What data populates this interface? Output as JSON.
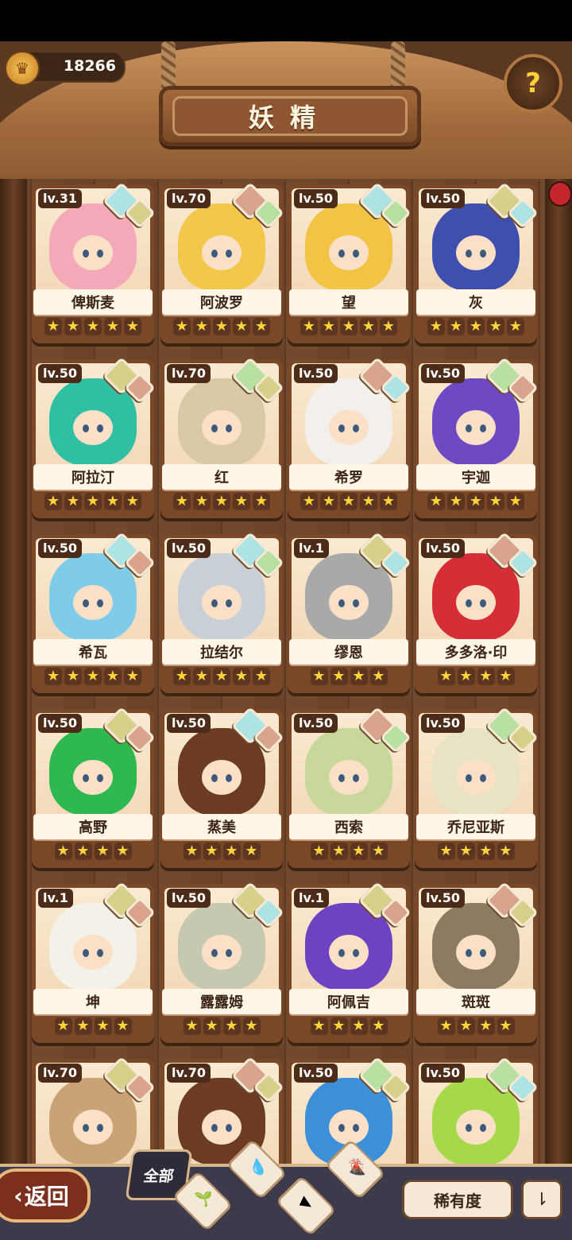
{
  "header": {
    "title": "妖精",
    "coins": "18266",
    "coin_icon": "crown-coin-icon",
    "help_icon": "question-sprout-icon"
  },
  "cards": [
    {
      "level": "lv.31",
      "name": "俾斯麦",
      "stars": 5,
      "hair": "#f4a9b8",
      "badges": [
        "#aee3e3",
        "#d8cf8a"
      ]
    },
    {
      "level": "lv.70",
      "name": "阿波罗",
      "stars": 5,
      "hair": "#f3c84a",
      "badges": [
        "#d9a38c",
        "#b8e0a0"
      ]
    },
    {
      "level": "lv.50",
      "name": "望",
      "stars": 5,
      "hair": "#f2c445",
      "badges": [
        "#aee3e3",
        "#b8e0a0"
      ]
    },
    {
      "level": "lv.50",
      "name": "灰",
      "stars": 5,
      "hair": "#3e4fae",
      "badges": [
        "#d8cf8a",
        "#aee3e3"
      ]
    },
    {
      "level": "lv.50",
      "name": "阿拉汀",
      "stars": 5,
      "hair": "#2fbfa3",
      "badges": [
        "#d8cf8a",
        "#d9a38c"
      ]
    },
    {
      "level": "lv.70",
      "name": "红",
      "stars": 5,
      "hair": "#d9c9a6",
      "badges": [
        "#b8e0a0",
        "#d8cf8a"
      ]
    },
    {
      "level": "lv.50",
      "name": "希罗",
      "stars": 5,
      "hair": "#f3f0ec",
      "badges": [
        "#d9a38c",
        "#aee3e3"
      ]
    },
    {
      "level": "lv.50",
      "name": "宇迦",
      "stars": 5,
      "hair": "#6d49c4",
      "badges": [
        "#b8e0a0",
        "#d9a38c"
      ]
    },
    {
      "level": "lv.50",
      "name": "希瓦",
      "stars": 5,
      "hair": "#7ecbea",
      "badges": [
        "#aee3e3",
        "#d9a38c"
      ]
    },
    {
      "level": "lv.50",
      "name": "拉结尔",
      "stars": 5,
      "hair": "#c9cfd6",
      "badges": [
        "#aee3e3",
        "#b8e0a0"
      ]
    },
    {
      "level": "lv.1",
      "name": "缪恩",
      "stars": 4,
      "hair": "#a9a9a9",
      "badges": [
        "#d8cf8a",
        "#aee3e3"
      ]
    },
    {
      "level": "lv.50",
      "name": "多多洛·印",
      "stars": 4,
      "hair": "#d62d36",
      "badges": [
        "#d9a38c",
        "#aee3e3"
      ]
    },
    {
      "level": "lv.50",
      "name": "高野",
      "stars": 4,
      "hair": "#2fb84f",
      "badges": [
        "#d8cf8a",
        "#d9a38c"
      ]
    },
    {
      "level": "lv.50",
      "name": "蒸美",
      "stars": 4,
      "hair": "#6b3c22",
      "badges": [
        "#aee3e3",
        "#d9a38c"
      ]
    },
    {
      "level": "lv.50",
      "name": "西索",
      "stars": 4,
      "hair": "#c8d79a",
      "badges": [
        "#d9a38c",
        "#b8e0a0"
      ]
    },
    {
      "level": "lv.50",
      "name": "乔尼亚斯",
      "stars": 4,
      "hair": "#e7e3c4",
      "badges": [
        "#b8e0a0",
        "#d8cf8a"
      ]
    },
    {
      "level": "lv.1",
      "name": "坤",
      "stars": 4,
      "hair": "#f4f2e8",
      "badges": [
        "#d8cf8a",
        "#d9a38c"
      ]
    },
    {
      "level": "lv.50",
      "name": "露露姆",
      "stars": 4,
      "hair": "#c7c8b0",
      "badges": [
        "#d8cf8a",
        "#aee3e3"
      ]
    },
    {
      "level": "lv.1",
      "name": "阿佩吉",
      "stars": 4,
      "hair": "#6f42c1",
      "badges": [
        "#d8cf8a",
        "#d9a38c"
      ]
    },
    {
      "level": "lv.50",
      "name": "斑斑",
      "stars": 4,
      "hair": "#8d7a62",
      "badges": [
        "#d9a38c",
        "#d8cf8a"
      ]
    },
    {
      "level": "lv.70",
      "name": "",
      "stars": 0,
      "hair": "#c9a275",
      "badges": [
        "#d8cf8a",
        "#d9a38c"
      ]
    },
    {
      "level": "lv.70",
      "name": "",
      "stars": 0,
      "hair": "#6b3c22",
      "badges": [
        "#d9a38c",
        "#d8cf8a"
      ]
    },
    {
      "level": "lv.50",
      "name": "",
      "stars": 0,
      "hair": "#3d8fd8",
      "badges": [
        "#b8e0a0",
        "#d8cf8a"
      ]
    },
    {
      "level": "lv.50",
      "name": "",
      "stars": 0,
      "hair": "#a6d94a",
      "badges": [
        "#b8e0a0",
        "#aee3e3"
      ]
    }
  ],
  "bottom_bar": {
    "back_label": "返回",
    "back_icon": "chevron-left-icon",
    "filter_all_label": "全部",
    "filter_icons": [
      "water-drop-icon",
      "sprout-icon",
      "mountain-icon",
      "volcano-icon"
    ],
    "rarity_label": "稀有度",
    "sort_icon": "sort-order-icon"
  }
}
